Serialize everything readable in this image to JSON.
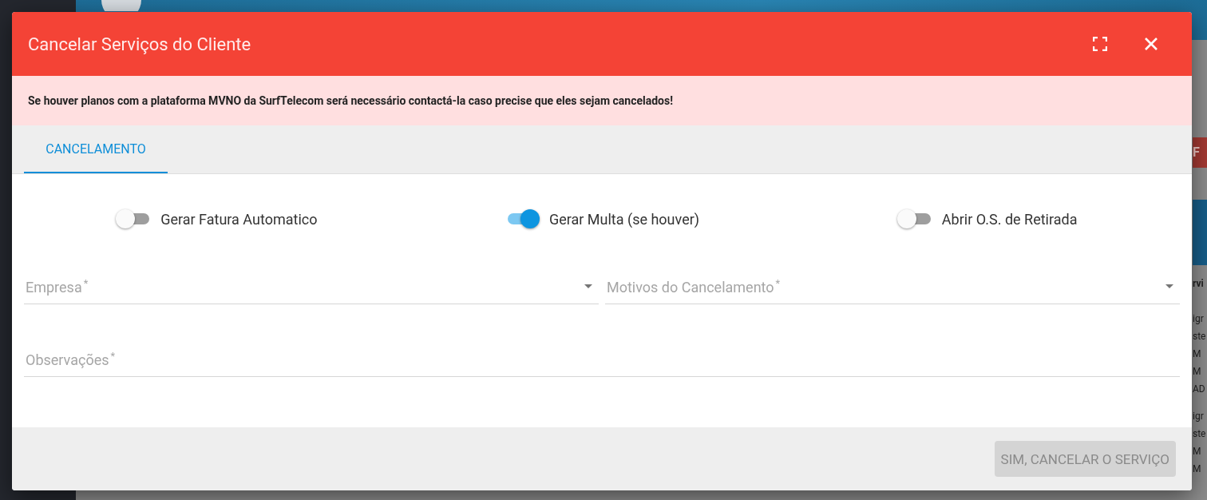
{
  "background": {
    "button": "F",
    "column_header": "rvi",
    "rows": [
      [
        "igr",
        "ste",
        "M",
        "M",
        "AD"
      ],
      [
        "igr",
        "ste",
        "M",
        "M"
      ]
    ]
  },
  "dialog": {
    "title": "Cancelar Serviços do Cliente",
    "alert": "Se houver planos com a plataforma MVNO da SurfTelecom será necessário contactá-la caso precise que eles sejam cancelados!",
    "tabs": [
      {
        "label": "CANCELAMENTO",
        "selected": true
      }
    ],
    "toggles": [
      {
        "label": "Gerar Fatura Automatico",
        "on": false
      },
      {
        "label": "Gerar Multa (se houver)",
        "on": true
      },
      {
        "label": "Abrir O.S. de Retirada",
        "on": false
      }
    ],
    "fields": [
      {
        "kind": "select",
        "label": "Empresa",
        "required_mark": "*"
      },
      {
        "kind": "select",
        "label": "Motivos do Cancelamento",
        "required_mark": "*"
      },
      {
        "kind": "text",
        "label": "Observações",
        "required_mark": "*"
      }
    ],
    "submit": {
      "label": "SIM, CANCELAR O SERVIÇO",
      "disabled": true
    }
  }
}
